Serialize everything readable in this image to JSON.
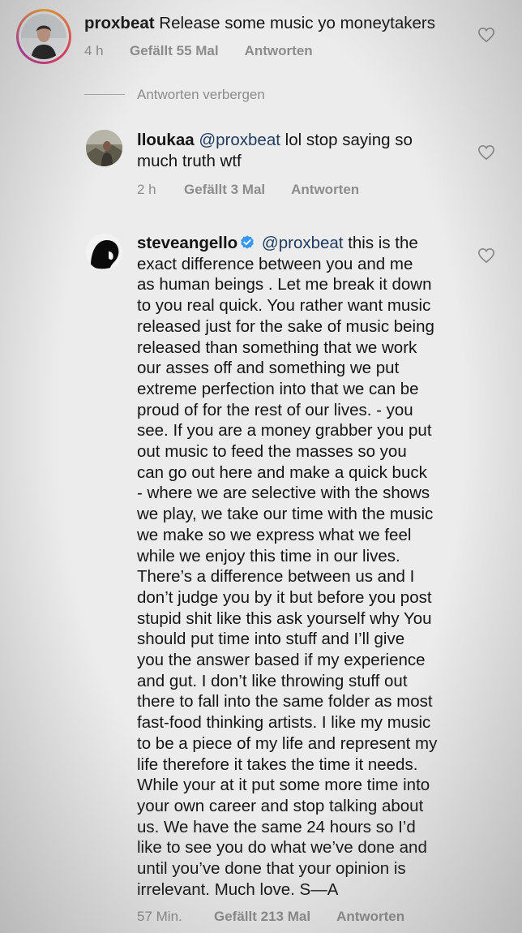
{
  "comments": [
    {
      "username": "proxbeat",
      "text": "Release some music yo moneytakers",
      "time": "4 h",
      "likes": "Gefällt 55 Mal",
      "reply_label": "Antworten"
    }
  ],
  "replies_toggle": "Antworten verbergen",
  "replies": [
    {
      "username": "lloukaa",
      "mention": "@proxbeat",
      "text_lines": [
        " lol stop saying so",
        "much truth wtf"
      ],
      "time": "2 h",
      "likes": "Gefällt 3 Mal",
      "reply_label": "Antworten"
    },
    {
      "username": "steveangello",
      "verified": true,
      "mention": "@proxbeat",
      "text_lines": [
        " this is the",
        "exact difference between you and me",
        "as human beings . Let me break it down",
        "to you real quick. You rather want music",
        "released just for the sake of music being",
        "released  than something that we work",
        "our asses off and something we put",
        "extreme perfection into that we can be",
        "proud of for the rest of our lives. - you",
        "see. If you are a money grabber you put",
        "out music to feed the masses so you",
        "can go out here and make a quick buck",
        "- where we are selective with the shows",
        "we play, we take our time with the music",
        "we make so we express what we feel",
        "while we enjoy this time in our lives.",
        "There’s a difference between us and I",
        "don’t judge you by it but before you post",
        "stupid shit like this ask yourself why You",
        "should put time into stuff and I’ll give",
        "you the answer based if my experience",
        "and gut. I don’t like throwing stuff out",
        "there to fall into the same folder as most",
        "fast-food thinking artists. I like my music",
        "to be a piece of my life and represent my",
        "life therefore it takes the time it needs.",
        "While your at it put some more time into",
        "your own career and stop talking about",
        "us. We have the same 24 hours so I’d",
        "like to see you do what we’ve done and",
        "until you’ve done that your opinion is",
        "irrelevant. Much love. S—A"
      ],
      "time": "57 Min.",
      "likes": "Gefällt 213 Mal",
      "reply_label": "Antworten"
    }
  ],
  "icons": {
    "heart": "heart-icon",
    "verified": "verified-badge-icon"
  },
  "colors": {
    "mention": "#1e3a5f",
    "meta": "#8c8c8c",
    "verified": "#3897f0"
  }
}
